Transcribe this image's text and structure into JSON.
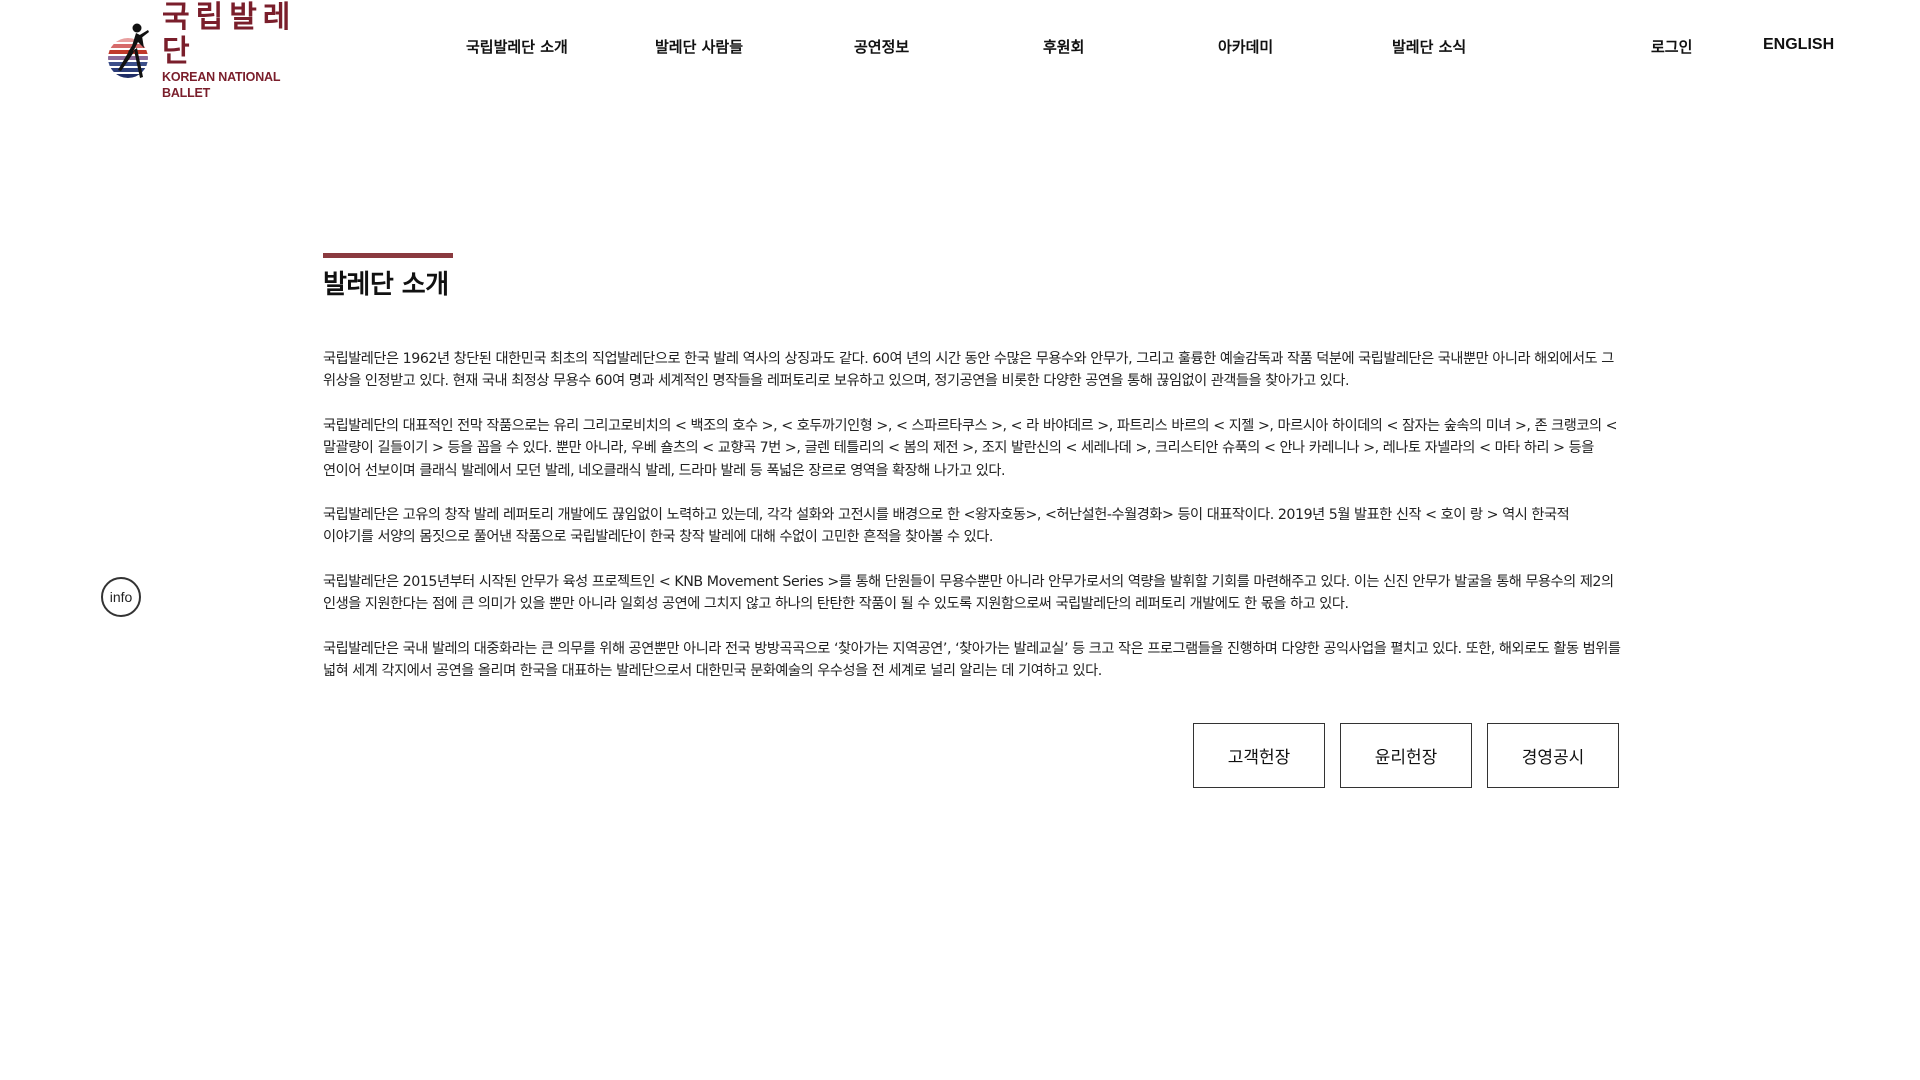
{
  "logo": {
    "korean": "국립발레단",
    "english": "KOREAN NATIONAL BALLET"
  },
  "nav": {
    "items": [
      {
        "label": "국립발레단 소개"
      },
      {
        "label": "발레단 사람들"
      },
      {
        "label": "공연정보"
      },
      {
        "label": "후원회"
      },
      {
        "label": "아카데미"
      },
      {
        "label": "발레단 소식"
      }
    ],
    "login": "로그인",
    "english": "ENGLISH"
  },
  "page": {
    "title": "발레단 소개",
    "paragraphs": [
      "국립발레단은 1962년 창단된 대한민국 최초의 직업발레단으로 한국 발레 역사의 상징과도 같다. 60여 년의 시간 동안 수많은 무용수와 안무가, 그리고 훌륭한 예술감독과 작품 덕분에 국립발레단은 국내뿐만 아니라 해외에서도 그 위상을 인정받고 있다. 현재 국내 최정상 무용수 60여 명과 세계적인 명작들을 레퍼토리로 보유하고 있으며, 정기공연을 비롯한 다양한 공연을 통해 끊임없이 관객들을 찾아가고 있다.",
      "국립발레단의 대표적인 전막 작품으로는 유리 그리고로비치의 < 백조의 호수 >, < 호두까기인형 >, < 스파르타쿠스 >, < 라 바야데르 >, 파트리스 바르의 < 지젤 >, 마르시아 하이데의 < 잠자는 숲속의 미녀 >, 존 크랭코의 < 말괄량이 길들이기 > 등을 꼽을 수 있다. 뿐만 아니라, 우베 숄츠의 < 교향곡 7번 >, 글렌 테틀리의 < 봄의 제전 >, 조지 발란신의 < 세레나데 >, 크리스티안 슈푹의 < 안나 카레니나 >, 레나토 자넬라의 < 마타 하리 > 등을 연이어 선보이며 클래식 발레에서 모던 발레, 네오클래식 발레, 드라마 발레 등 폭넓은 장르로 영역을 확장해 나가고 있다.",
      "국립발레단은 고유의 창작 발레 레퍼토리 개발에도 끊임없이 노력하고 있는데, 각각 설화와 고전시를 배경으로 한 <왕자호동>, <허난설헌-수월경화> 등이 대표작이다. 2019년 5월 발표한 신작 < 호이 랑 > 역시 한국적 이야기를 서양의 몸짓으로 풀어낸 작품으로 국립발레단이 한국 창작 발레에 대해 수없이 고민한 흔적을 찾아볼 수 있다.",
      "국립발레단은 2015년부터 시작된 안무가 육성 프로젝트인 < KNB Movement Series >를 통해 단원들이 무용수뿐만 아니라 안무가로서의 역량을 발휘할 기회를 마련해주고 있다. 이는 신진 안무가 발굴을 통해 무용수의 제2의 인생을 지원한다는 점에 큰 의미가 있을 뿐만 아니라 일회성 공연에 그치지 않고 하나의 탄탄한 작품이 될 수 있도록 지원함으로써 국립발레단의 레퍼토리 개발에도 한 몫을 하고 있다.",
      "국립발레단은 국내 발레의 대중화라는 큰 의무를 위해 공연뿐만 아니라 전국 방방곡곡으로 ‘찾아가는 지역공연’, ‘찾아가는 발레교실’ 등 크고 작은 프로그램들을 진행하며 다양한 공익사업을 펼치고 있다. 또한, 해외로도 활동 범위를 넓혀 세계 각지에서 공연을 올리며 한국을 대표하는 발레단으로서 대한민국 문화예술의 우수성을 전 세계로 널리 알리는 데 기여하고 있다."
    ],
    "buttons": [
      {
        "label": "고객헌장"
      },
      {
        "label": "윤리헌장"
      },
      {
        "label": "경영공시"
      }
    ]
  },
  "info_badge": "info",
  "colors": {
    "brand": "#7a1e2b",
    "title_bar": "#8a3a3f",
    "logo_blue": "#3c4f8a",
    "logo_red": "#c0392b"
  }
}
